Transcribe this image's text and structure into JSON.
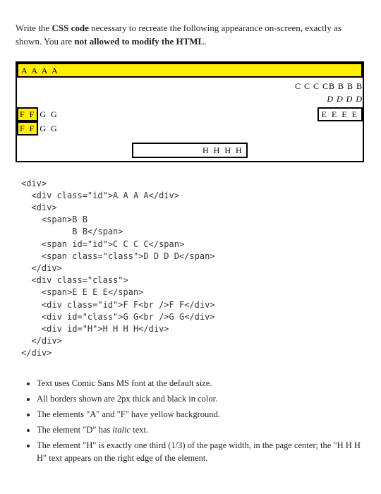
{
  "intro": {
    "part1": "Write the ",
    "bold1": "CSS code",
    "part2": " necessary to recreate the following appearance on-screen, exactly as shown. You are ",
    "bold2": "not allowed to modify the HTML",
    "part3": "."
  },
  "mock": {
    "a": "A A A A",
    "c_combined": "C C C CB B B B",
    "d": "D D D D",
    "f": "F F",
    "g": "G G",
    "e": "E E E E",
    "h": "H H H H"
  },
  "code": "<div>\n  <div class=\"id\">A A A A</div>\n  <div>\n    <span>B B\n          B B</span>\n    <span id=\"id\">C C C C</span>\n    <span class=\"class\">D D D D</span>\n  </div>\n  <div class=\"class\">\n    <span>E E E E</span>\n    <div class=\"id\">F F<br />F F</div>\n    <div id=\"class\">G G<br />G G</div>\n    <div id=\"H\">H H H H</div>\n  </div>\n</div>",
  "notes": {
    "n0a": "Text uses Comic Sans MS font at the default size.",
    "n1a": "All borders shown are 2px thick and black in color.",
    "n2a": "The elements \"A\" and \"F\" have yellow background.",
    "n3a": "The element \"D\" has ",
    "n3b": "italic",
    "n3c": " text.",
    "n4a": "The element \"H\" is exactly one third (1/3) of the page width, in the page center; the \"H H H H\" text appears on the right edge of the element."
  }
}
